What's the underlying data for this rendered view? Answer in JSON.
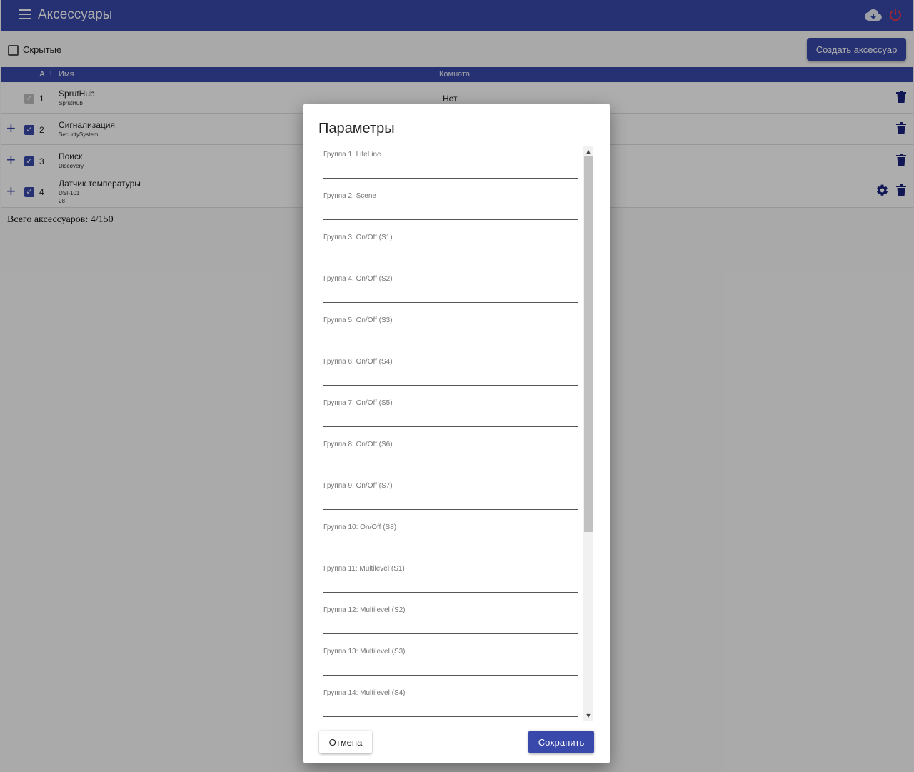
{
  "header": {
    "title": "Аксессуары",
    "menu_icon": "hamburger-menu-icon",
    "cloud_icon": "cloud-download-icon",
    "power_icon": "power-icon"
  },
  "toolbar": {
    "hidden_label": "Скрытые",
    "hidden_checked": false,
    "create_label": "Создать аксессуар"
  },
  "table": {
    "col_a": "A",
    "col_name": "Имя",
    "col_room": "Комната",
    "rows": [
      {
        "num": "1",
        "name": "SprutHub",
        "sub": "SprutHub",
        "room": "Нет",
        "checked": true,
        "disabled": true
      },
      {
        "num": "2",
        "name": "Сигнализация",
        "sub": "SecuritySystem",
        "checked": true
      },
      {
        "num": "3",
        "name": "Поиск",
        "sub": "Discovery",
        "checked": true
      },
      {
        "num": "4",
        "name": "Датчик температуры",
        "sub": "DSI-101",
        "sub2": "28",
        "checked": true
      }
    ]
  },
  "footer": {
    "total": "Всего аксессуаров: 4/150"
  },
  "dialog": {
    "title": "Параметры",
    "fields": [
      {
        "label": "Группа 1: LifeLine",
        "value": ""
      },
      {
        "label": "Группа 2: Scene",
        "value": ""
      },
      {
        "label": "Группа 3: On/Off (S1)",
        "value": ""
      },
      {
        "label": "Группа 4: On/Off (S2)",
        "value": ""
      },
      {
        "label": "Группа 5: On/Off (S3)",
        "value": ""
      },
      {
        "label": "Группа 6: On/Off (S4)",
        "value": ""
      },
      {
        "label": "Группа 7: On/Off (S5)",
        "value": ""
      },
      {
        "label": "Группа 8: On/Off (S6)",
        "value": ""
      },
      {
        "label": "Группа 9: On/Off (S7)",
        "value": ""
      },
      {
        "label": "Группа 10: On/Off (S8)",
        "value": ""
      },
      {
        "label": "Группа 11: Multilevel (S1)",
        "value": ""
      },
      {
        "label": "Группа 12: Multilevel (S2)",
        "value": ""
      },
      {
        "label": "Группа 13: Multilevel (S3)",
        "value": ""
      },
      {
        "label": "Группа 14: Multilevel (S4)",
        "value": ""
      }
    ],
    "cancel_label": "Отмена",
    "save_label": "Сохранить"
  },
  "colors": {
    "primary": "#3949ab",
    "power": "#e53950",
    "overlay": "rgba(0,0,0,0.32)"
  }
}
